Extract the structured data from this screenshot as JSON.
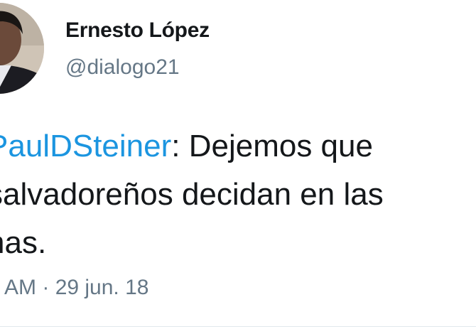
{
  "author": {
    "display_name": "Ernesto López",
    "handle": "@dialogo21",
    "avatar_icon": "profile-photo"
  },
  "tweet": {
    "line1_mention": "PaulDSteiner",
    "line1_rest": ": Dejemos que",
    "line2": "salvadoreños decidan en las",
    "line3": "nas."
  },
  "meta": {
    "time": "AM",
    "separator": "·",
    "date": "29 jun. 18"
  },
  "colors": {
    "mention": "#1b95e0",
    "secondary_text": "#657786",
    "primary_text": "#14171a"
  }
}
